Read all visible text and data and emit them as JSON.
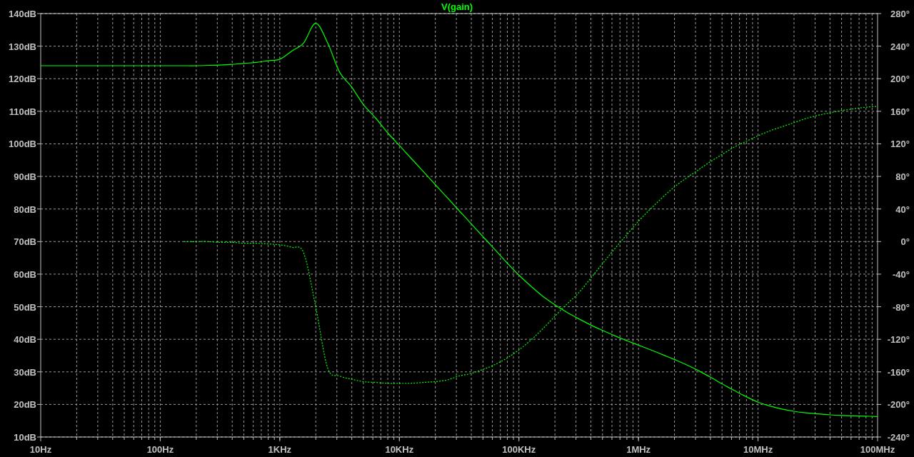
{
  "magnitude_plot": {
    "chart_data": {
      "type": "line",
      "title": "V(gain)",
      "grid": true,
      "categories": [
        "10Hz",
        null,
        null,
        null,
        null,
        null,
        null,
        null,
        null,
        null,
        "100Hz",
        null,
        null,
        null,
        null,
        null,
        null,
        null,
        null,
        null,
        "1KHz",
        null,
        null,
        null,
        null,
        null,
        null,
        null,
        null,
        null,
        "10KHz",
        null,
        null,
        null,
        null,
        null,
        null,
        null,
        null,
        null,
        "100KHz",
        null,
        null,
        null,
        null,
        null,
        null,
        null,
        null,
        null,
        "1MHz",
        null,
        null,
        null,
        null,
        null,
        null,
        null,
        null,
        null,
        "10MHz",
        null,
        null,
        null,
        null,
        null,
        null,
        null,
        null,
        null,
        "100MHz"
      ],
      "ylim": [
        10,
        140
      ],
      "yticks": [
        {
          "value": 140,
          "label": "140dB"
        },
        {
          "value": 130,
          "label": "130dB"
        },
        {
          "value": 120,
          "label": "120dB"
        },
        {
          "value": 110,
          "label": "110dB"
        },
        {
          "value": 100,
          "label": "100dB"
        },
        {
          "value": 90,
          "label": "90dB"
        },
        {
          "value": 80,
          "label": "80dB"
        },
        {
          "value": 70,
          "label": "70dB"
        },
        {
          "value": 60,
          "label": "60dB"
        },
        {
          "value": 50,
          "label": "50dB"
        },
        {
          "value": 40,
          "label": "40dB"
        },
        {
          "value": 30,
          "label": "30dB"
        },
        {
          "value": 20,
          "label": "20dB"
        },
        {
          "value": 10,
          "label": "10dB"
        }
      ],
      "series": [
        {
          "color": "#00ff00",
          "line_style": "solid",
          "values": [
            124,
            124,
            124,
            124,
            124,
            124,
            124,
            124,
            124,
            124,
            124,
            124,
            124,
            124,
            124.1,
            124.2,
            124.4,
            124.7,
            125,
            125.5,
            126,
            128.5,
            131,
            137,
            131,
            122,
            117.5,
            112,
            108,
            103.5,
            99.5,
            95.5,
            91.5,
            87.5,
            83.5,
            79.5,
            75.5,
            71.5,
            67.5,
            63.5,
            59.7,
            56.3,
            53.2,
            50.6,
            48.3,
            46.3,
            44.4,
            42.7,
            41.1,
            39.6,
            38.2,
            36.8,
            35.3,
            33.8,
            32.2,
            30.4,
            28.4,
            26.3,
            24.3,
            22.4,
            20.7,
            19.5,
            18.6,
            17.9,
            17.4,
            17.1,
            16.8,
            16.6,
            16.5,
            16.4,
            16.3
          ]
        }
      ]
    }
  },
  "phase_plot": {
    "chart_data": {
      "type": "line",
      "ylim": [
        -240,
        280
      ],
      "yticks": [
        {
          "value": 280,
          "label": "280°"
        },
        {
          "value": 240,
          "label": "240°"
        },
        {
          "value": 200,
          "label": "200°"
        },
        {
          "value": 160,
          "label": "160°"
        },
        {
          "value": 120,
          "label": "120°"
        },
        {
          "value": 80,
          "label": "80°"
        },
        {
          "value": 40,
          "label": "40°"
        },
        {
          "value": 0,
          "label": "0°"
        },
        {
          "value": -40,
          "label": "-40°"
        },
        {
          "value": -80,
          "label": "-80°"
        },
        {
          "value": -120,
          "label": "-120°"
        },
        {
          "value": -160,
          "label": "-160°"
        },
        {
          "value": -200,
          "label": "-200°"
        },
        {
          "value": -240,
          "label": "-240°"
        }
      ],
      "series": [
        {
          "color": "#00ff00",
          "line_style": "dashed",
          "values": [
            null,
            null,
            null,
            null,
            null,
            null,
            null,
            null,
            null,
            null,
            null,
            null,
            0,
            0,
            0,
            -1,
            -1,
            -2,
            -2,
            -3,
            -4,
            -7,
            -14,
            -80,
            -155,
            -165,
            -169,
            -172,
            -173,
            -174,
            -174,
            -174,
            -173,
            -172,
            -170,
            -165,
            -162,
            -157,
            -151,
            -143,
            -133,
            -121,
            -107,
            -92,
            -77,
            -63,
            -45,
            -27,
            -9,
            8,
            25,
            40,
            54,
            67,
            78,
            88,
            98,
            107,
            116,
            123,
            130,
            136,
            141,
            146,
            151,
            155,
            158,
            161,
            163,
            165,
            166
          ]
        }
      ]
    }
  }
}
